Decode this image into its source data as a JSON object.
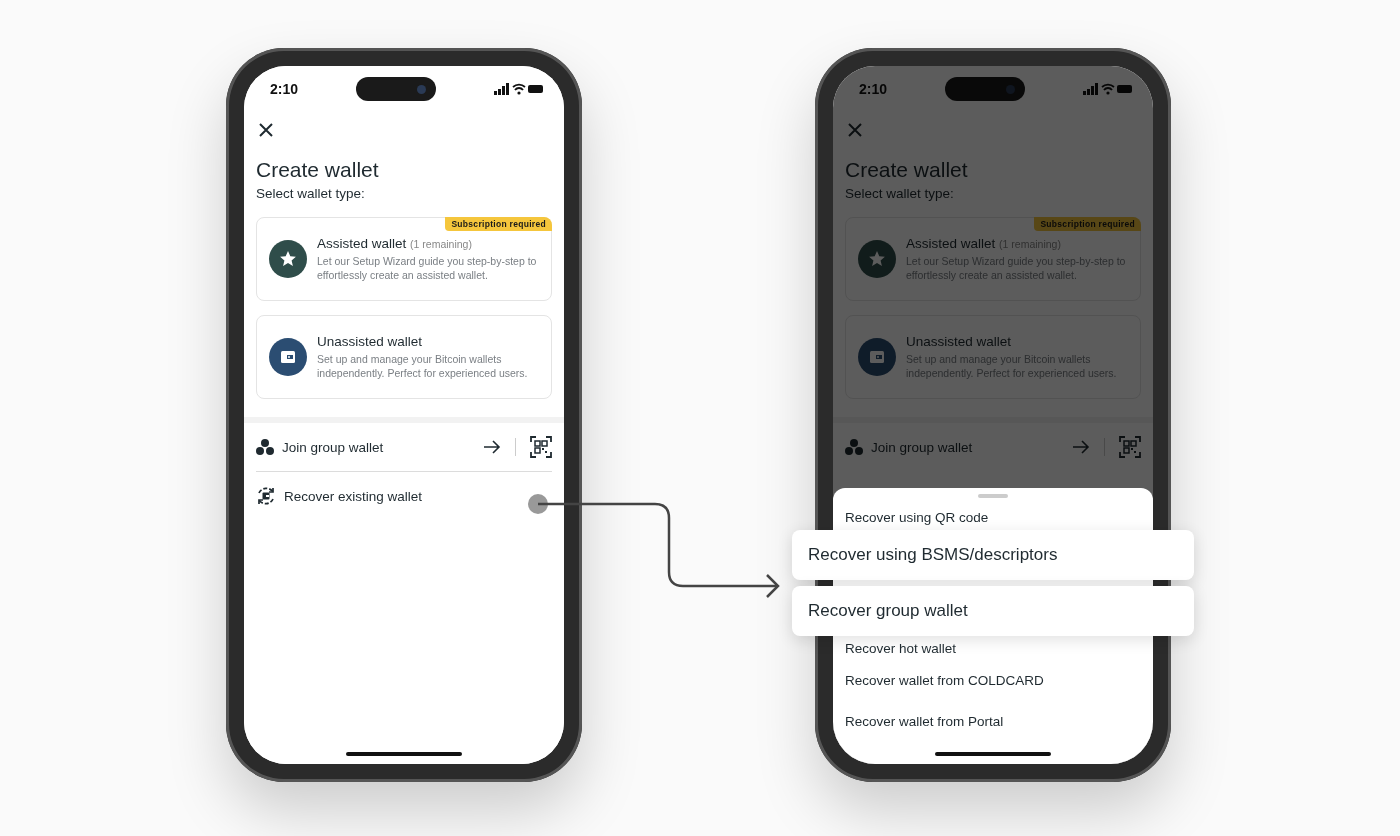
{
  "phones": [
    {
      "dimmed": false,
      "status_bar": {
        "time": "2:10"
      },
      "title": "Create wallet",
      "subtitle": "Select wallet type:",
      "cards": [
        {
          "kind": "assisted",
          "title": "Assisted wallet",
          "note": "(1 remaining)",
          "description": "Let our Setup Wizard guide you step-by-step to effortlessly create an assisted wallet.",
          "badge": "Subscription required"
        },
        {
          "kind": "unassisted",
          "title": "Unassisted wallet",
          "description": "Set up and manage your Bitcoin wallets independently. Perfect for experienced users."
        }
      ],
      "actions": [
        {
          "kind": "join",
          "label": "Join group wallet"
        },
        {
          "kind": "recover",
          "label": "Recover existing wallet"
        }
      ]
    },
    {
      "dimmed": true,
      "status_bar": {
        "time": "2:10"
      },
      "title": "Create wallet",
      "subtitle": "Select wallet type:",
      "cards": [
        {
          "kind": "assisted",
          "title": "Assisted wallet",
          "note": "(1 remaining)",
          "description": "Let our Setup Wizard guide you step-by-step to effortlessly create an assisted wallet.",
          "badge": "Subscription required"
        },
        {
          "kind": "unassisted",
          "title": "Unassisted wallet",
          "description": "Set up and manage your Bitcoin wallets independently. Perfect for experienced users."
        }
      ],
      "actions": [
        {
          "kind": "join",
          "label": "Join group wallet"
        }
      ],
      "sheet": {
        "options": [
          {
            "label": "Recover using QR code",
            "highlighted": false
          },
          {
            "label": "Recover using BSMS/descriptors",
            "highlighted": true
          },
          {
            "label": "Recover group wallet",
            "highlighted": true
          },
          {
            "label": "Recover hot wallet",
            "highlighted": false
          },
          {
            "label": "Recover wallet from COLDCARD",
            "highlighted": false
          },
          {
            "label": "Recover wallet from Portal",
            "highlighted": false
          }
        ]
      }
    }
  ]
}
